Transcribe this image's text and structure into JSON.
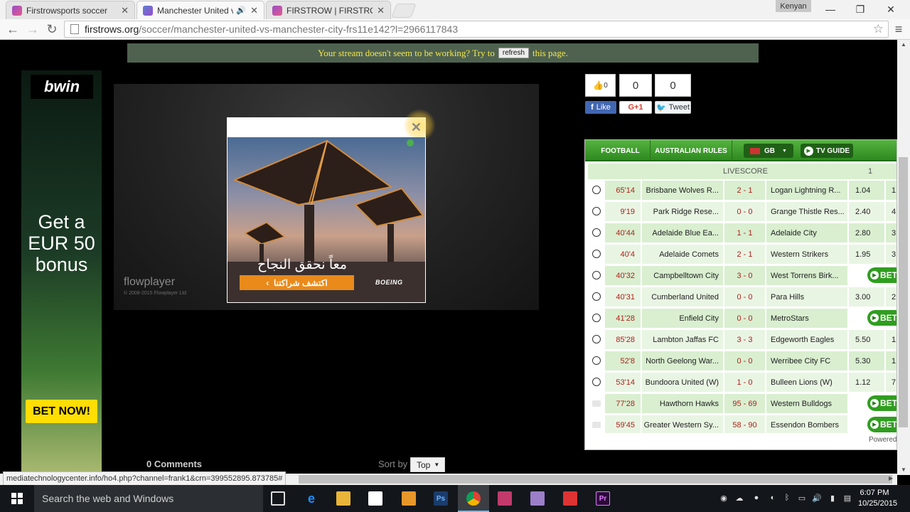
{
  "browser": {
    "tabs": [
      {
        "label": "Firstrowsports soccer",
        "active": false
      },
      {
        "label": "Manchester United vs M",
        "active": true,
        "audio": "speaker-icon"
      },
      {
        "label": "FIRSTROW | FIRSTROWSPO",
        "active": false
      }
    ],
    "user_badge": "Kenyan",
    "url_host": "firstrows.org",
    "url_path": "/soccer/manchester-united-vs-manchester-city-frs11e142?l=2966117843",
    "status_url": "mediatechnologycenter.info/ho4.php?channel=frank1&crn=399552895.873785#"
  },
  "notice": {
    "before": "Your stream doesn't seem to be working? Try to",
    "button": "refresh",
    "after": "this page."
  },
  "left_ad": {
    "brand": "bwin",
    "line1": "Get a",
    "line2": "EUR 50",
    "line3": "bonus",
    "cta": "BET NOW!"
  },
  "player": {
    "logo": "flowplayer",
    "copyright": "© 2008-2015 Flowplayer Ltd",
    "ad_headline": "معاً نحقق النجاح",
    "ad_button": "اكتشف شراكتنا",
    "ad_brand": "BOEING"
  },
  "social": {
    "like_count": "0",
    "gplus_count": "0",
    "tweet_count": "0",
    "like_label": "Like",
    "gplus_label": "G+1",
    "tweet_label": "Tweet"
  },
  "widget": {
    "tabs": {
      "football": "FOOTBALL",
      "australian": "AUSTRALIAN RULES",
      "region": "GB",
      "tv": "TV GUIDE"
    },
    "header": "LIVESCORE",
    "header_col": "1",
    "bet_label": "BET",
    "footer": "Powered",
    "matches": [
      {
        "time": "65'14",
        "home": "Brisbane Wolves R...",
        "score": "2 - 1",
        "away": "Logan Lightning R...",
        "odd1": "1.04",
        "odd2": "1",
        "bet": false,
        "sport": "football"
      },
      {
        "time": "9'19",
        "home": "Park Ridge Rese...",
        "score": "0 - 0",
        "away": "Grange Thistle Res...",
        "odd1": "2.40",
        "odd2": "4",
        "bet": false,
        "sport": "football"
      },
      {
        "time": "40'44",
        "home": "Adelaide Blue Ea...",
        "score": "1 - 1",
        "away": "Adelaide City",
        "odd1": "2.80",
        "odd2": "3",
        "bet": false,
        "sport": "football"
      },
      {
        "time": "40'4",
        "home": "Adelaide Comets",
        "score": "2 - 1",
        "away": "Western Strikers",
        "odd1": "1.95",
        "odd2": "3",
        "bet": false,
        "sport": "football"
      },
      {
        "time": "40'32",
        "home": "Campbelltown City",
        "score": "3 - 0",
        "away": "West Torrens Birk...",
        "odd1": "",
        "odd2": "",
        "bet": true,
        "sport": "football"
      },
      {
        "time": "40'31",
        "home": "Cumberland United",
        "score": "0 - 0",
        "away": "Para Hills",
        "odd1": "3.00",
        "odd2": "2",
        "bet": false,
        "sport": "football"
      },
      {
        "time": "41'28",
        "home": "Enfield City",
        "score": "0 - 0",
        "away": "MetroStars",
        "odd1": "",
        "odd2": "",
        "bet": true,
        "sport": "football"
      },
      {
        "time": "85'28",
        "home": "Lambton Jaffas FC",
        "score": "3 - 3",
        "away": "Edgeworth Eagles",
        "odd1": "5.50",
        "odd2": "1",
        "bet": false,
        "sport": "football"
      },
      {
        "time": "52'8",
        "home": "North Geelong War...",
        "score": "0 - 0",
        "away": "Werribee City FC",
        "odd1": "5.30",
        "odd2": "1",
        "bet": false,
        "sport": "football"
      },
      {
        "time": "53'14",
        "home": "Bundoora United (W)",
        "score": "1 - 0",
        "away": "Bulleen Lions (W)",
        "odd1": "1.12",
        "odd2": "7",
        "bet": false,
        "sport": "football"
      },
      {
        "time": "77'28",
        "home": "Hawthorn Hawks",
        "score": "95 - 69",
        "away": "Western Bulldogs",
        "odd1": "",
        "odd2": "",
        "bet": true,
        "sport": "aussie"
      },
      {
        "time": "59'45",
        "home": "Greater Western Sy...",
        "score": "58 - 90",
        "away": "Essendon Bombers",
        "odd1": "",
        "odd2": "",
        "bet": true,
        "sport": "aussie"
      }
    ]
  },
  "comments": {
    "count": "0 Comments",
    "sort_label": "Sort by",
    "sort_value": "Top"
  },
  "taskbar": {
    "search_placeholder": "Search the web and Windows",
    "time": "6:07 PM",
    "date": "10/25/2015"
  }
}
